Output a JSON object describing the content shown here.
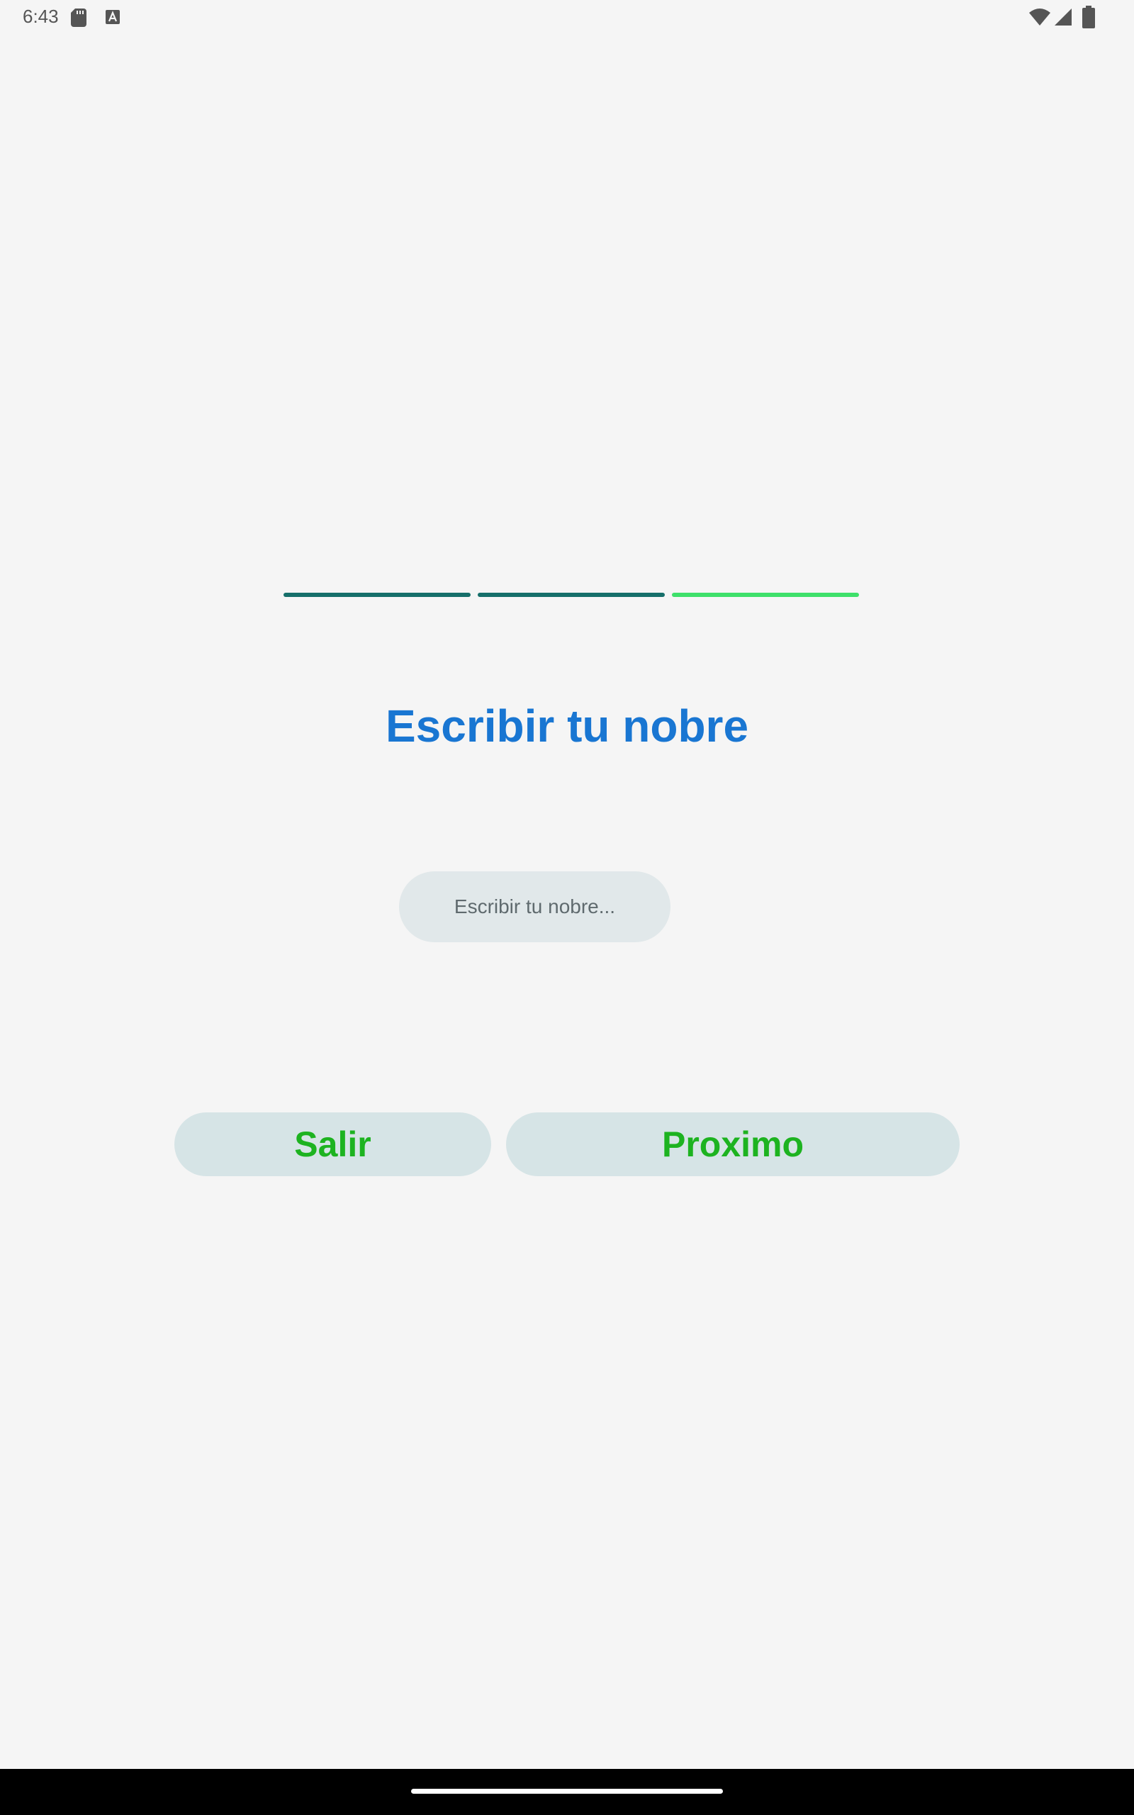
{
  "status_bar": {
    "time": "6:43",
    "left_icons": [
      "sd-card-icon",
      "text-a-icon"
    ],
    "right_icons": [
      "wifi-icon",
      "signal-icon",
      "battery-icon"
    ]
  },
  "progress": {
    "total_steps": 3,
    "current_step": 3,
    "colors": {
      "completed": "#166f6a",
      "current": "#3ee06a"
    }
  },
  "title": "Escribir tu nobre",
  "name_input": {
    "value": "",
    "placeholder": "Escribir tu nobre..."
  },
  "buttons": {
    "exit_label": "Salir",
    "next_label": "Proximo"
  },
  "colors": {
    "title": "#1976d2",
    "button_text": "#1db320",
    "button_bg": "#d6e4e6",
    "input_bg": "#e1e8ea",
    "background": "#f5f5f5"
  }
}
